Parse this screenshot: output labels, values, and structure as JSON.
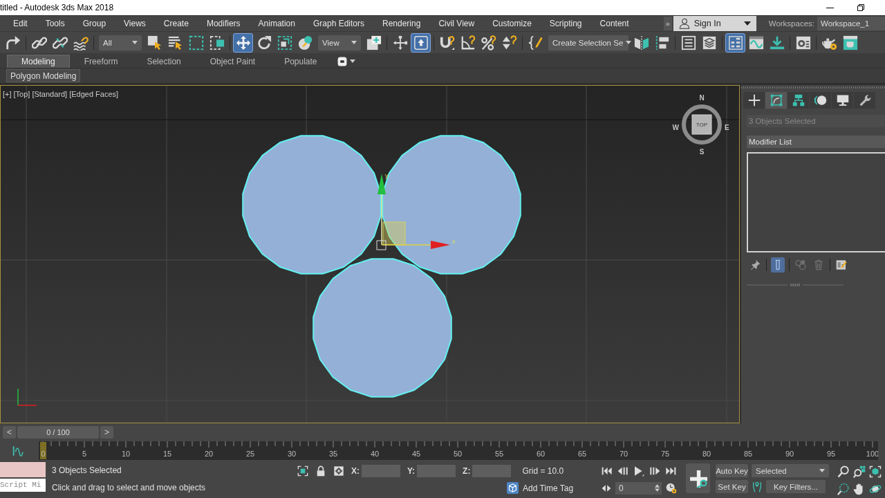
{
  "window": {
    "title": "titled - Autodesk 3ds Max 2018"
  },
  "menu_bar": {
    "items": [
      "Edit",
      "Tools",
      "Group",
      "Views",
      "Create",
      "Modifiers",
      "Animation",
      "Graph Editors",
      "Rendering",
      "Civil View",
      "Customize",
      "Scripting",
      "Content"
    ],
    "overflow": "»"
  },
  "account": {
    "label": "Sign In"
  },
  "workspaces": {
    "label": "Workspaces:",
    "value": "Workspace_1"
  },
  "toolbar": {
    "selection_filter": "All",
    "coordinate_system": "View",
    "named_selection": "Create Selection Se",
    "buttons": [
      {
        "selected": false
      },
      {
        "selected": false
      },
      {
        "selected": false
      },
      {
        "selected": false
      },
      {
        "selected": false
      },
      {
        "selected": false
      },
      {
        "selected": false
      },
      {
        "selected": false
      },
      {
        "selected": true
      },
      {
        "selected": false
      },
      {
        "selected": false
      },
      {
        "selected": false
      },
      {
        "selected": false
      },
      {
        "selected": false
      },
      {
        "selected": true
      },
      {
        "selected": false
      },
      {
        "selected": false
      },
      {
        "selected": false
      },
      {
        "selected": false
      },
      {
        "selected": false
      },
      {
        "selected": false
      },
      {
        "selected": false
      },
      {
        "selected": false
      },
      {
        "selected": false
      },
      {
        "selected": true
      },
      {
        "selected": false
      },
      {
        "selected": false
      },
      {
        "selected": false
      },
      {
        "selected": false
      },
      {
        "selected": false
      }
    ]
  },
  "ribbon": {
    "tabs": [
      {
        "label": "Modeling",
        "selected": true
      },
      {
        "label": "Freeform",
        "selected": false
      },
      {
        "label": "Selection",
        "selected": false
      },
      {
        "label": "Object Paint",
        "selected": false
      },
      {
        "label": "Populate",
        "selected": false
      }
    ],
    "panel": "Polygon Modeling"
  },
  "viewport": {
    "labels": [
      "[+]",
      "[Top]",
      "[Standard]",
      "[Edged Faces]"
    ],
    "gizmo_axes": {
      "x": "x",
      "y": "y"
    },
    "viewcube": {
      "face": "TOP",
      "north": "N",
      "east": "E",
      "south": "S",
      "west": "W"
    }
  },
  "command_panel": {
    "tabs": [
      {
        "selected": false
      },
      {
        "selected": true
      },
      {
        "selected": false
      },
      {
        "selected": false
      },
      {
        "selected": false
      },
      {
        "selected": false
      }
    ],
    "name_field": {
      "value": "3 Objects Selected",
      "disabled": true
    },
    "modifier_list": "Modifier List",
    "stack_buttons": [
      {
        "selected": false,
        "disabled": false
      },
      {
        "selected": true,
        "disabled": false
      },
      {
        "selected": false,
        "disabled": true
      },
      {
        "selected": false,
        "disabled": true
      },
      {
        "selected": false,
        "disabled": false
      }
    ]
  },
  "timeline": {
    "slider": {
      "prev": "<",
      "label": "0 / 100",
      "next": ">",
      "level": 0
    },
    "current_frame": "0",
    "frame_labels": [
      "5",
      "10",
      "15",
      "20",
      "25",
      "30",
      "35",
      "40",
      "45",
      "50",
      "55",
      "60",
      "65",
      "70",
      "75",
      "80",
      "85",
      "90",
      "95",
      "100"
    ]
  },
  "status_bar": {
    "listener": "Script Mi",
    "selection": "3 Objects Selected",
    "prompt": "Click and drag to select and move objects",
    "coordinates": [
      {
        "label": "X:"
      },
      {
        "label": "Y:"
      },
      {
        "label": "Z:"
      }
    ],
    "grid": "Grid = 10.0",
    "time_tag": "Add Time Tag",
    "frame": "0",
    "auto_key": "Auto Key",
    "set_key": "Set Key",
    "key_target": "Selected",
    "key_filters": "Key Filters..."
  }
}
